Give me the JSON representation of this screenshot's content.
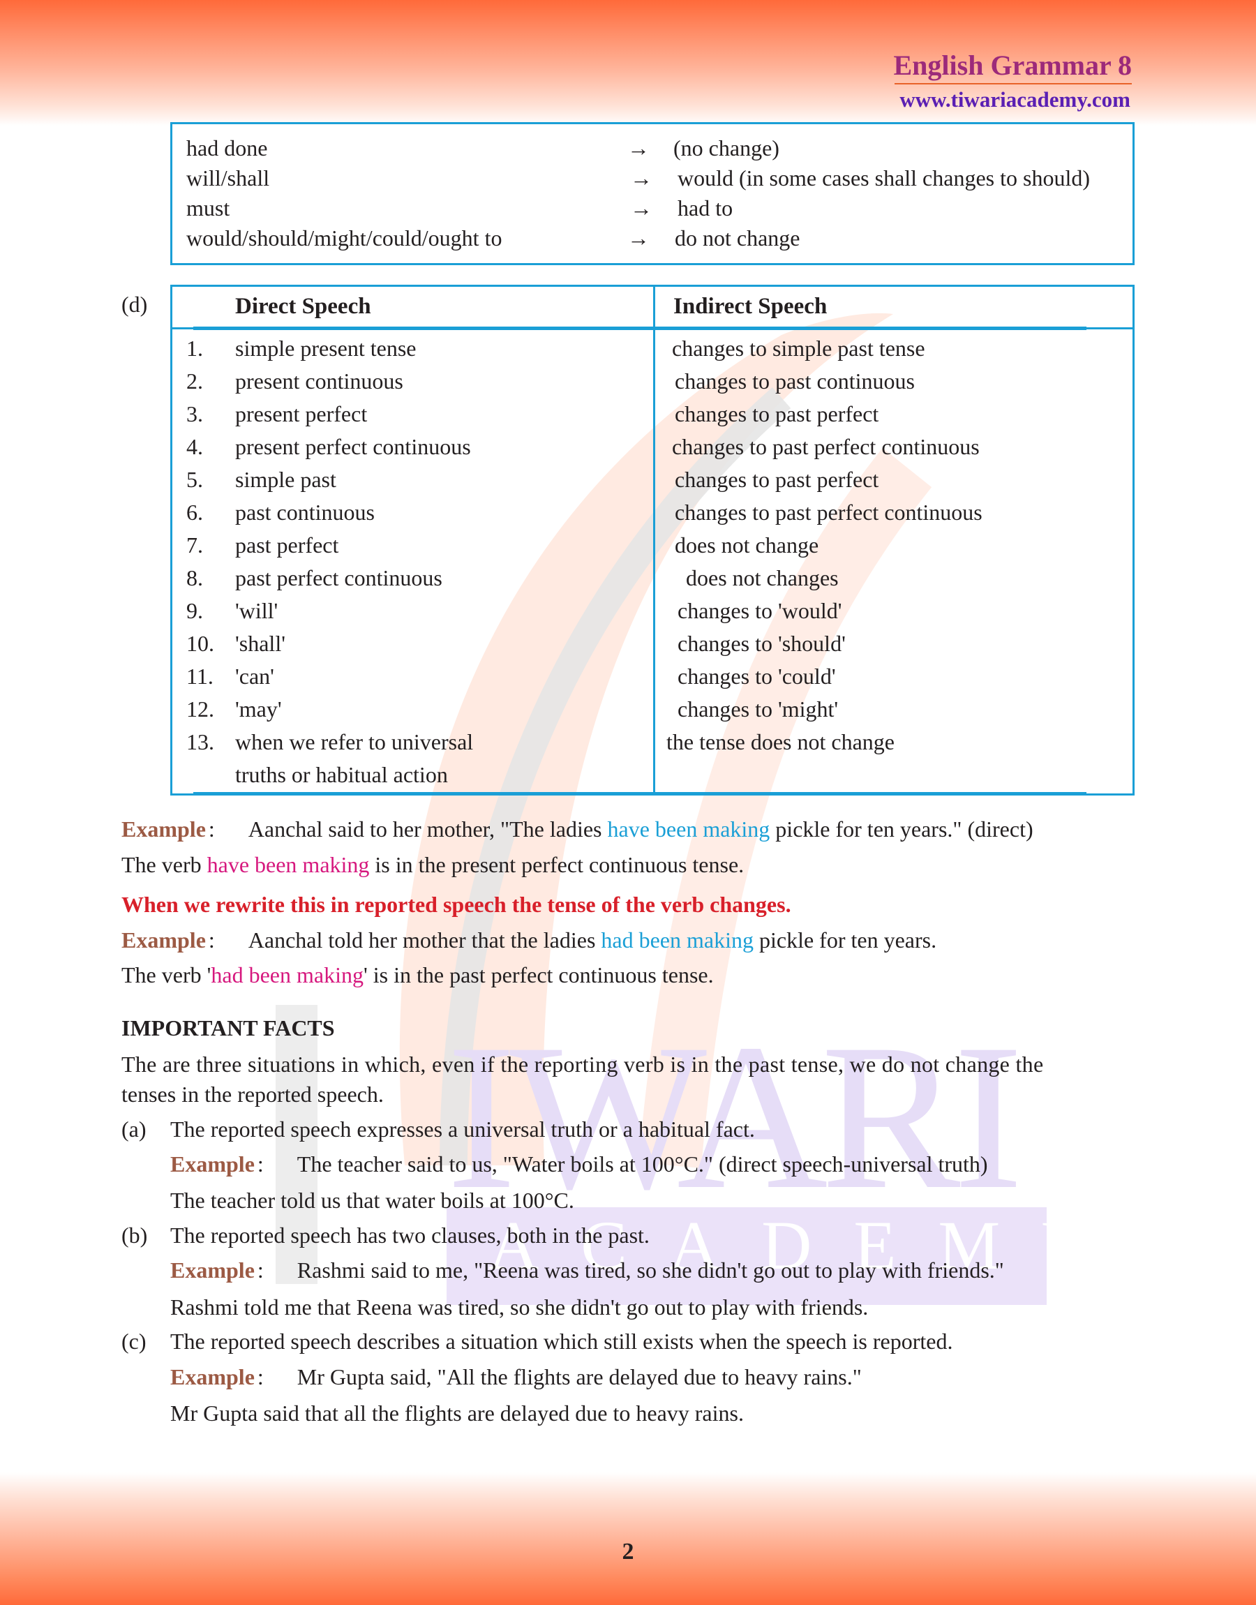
{
  "header": {
    "title": "English Grammar 8",
    "url": "www.tiwariacademy.com"
  },
  "watermark": {
    "word1": "IWARI",
    "word2": "ACADEMY"
  },
  "modal_table": {
    "arrow": "→",
    "rows": [
      {
        "from": "had done",
        "to": "(no change)"
      },
      {
        "from": "will/shall",
        "to": "would (in some cases shall changes to should)"
      },
      {
        "from": "must",
        "to": "had to"
      },
      {
        "from": "would/should/might/could/ought to",
        "to": "do not change"
      }
    ]
  },
  "tense_table": {
    "label": "(d)",
    "headers": {
      "direct": "Direct Speech",
      "indirect": "Indirect Speech"
    },
    "rows": [
      {
        "num": "1.",
        "direct": "simple present tense",
        "indirect": "changes to simple past tense"
      },
      {
        "num": "2.",
        "direct": "present continuous",
        "indirect": "changes to past continuous"
      },
      {
        "num": "3.",
        "direct": "present perfect",
        "indirect": "changes to past perfect"
      },
      {
        "num": "4.",
        "direct": "present perfect continuous",
        "indirect": "changes to past perfect continuous"
      },
      {
        "num": "5.",
        "direct": "simple past",
        "indirect": "changes to past perfect"
      },
      {
        "num": "6.",
        "direct": "past continuous",
        "indirect": "changes to past perfect continuous"
      },
      {
        "num": "7.",
        "direct": "past perfect",
        "indirect": "does not change"
      },
      {
        "num": "8.",
        "direct": "past perfect continuous",
        "indirect": "does not changes"
      },
      {
        "num": "9.",
        "direct": "'will'",
        "indirect": "changes to 'would'"
      },
      {
        "num": "10.",
        "direct": "'shall'",
        "indirect": "changes to 'should'"
      },
      {
        "num": "11.",
        "direct": "'can'",
        "indirect": "changes to 'could'"
      },
      {
        "num": "12.",
        "direct": "'may'",
        "indirect": "changes to 'might'"
      },
      {
        "num": "13.",
        "direct": "when we refer to universal",
        "indirect": "the tense does not change"
      },
      {
        "num": "",
        "direct": "truths or habitual action",
        "indirect": ""
      }
    ]
  },
  "examples": {
    "label": "Example",
    "colon": ":",
    "ex1": {
      "pre": "Aanchal said to her mother, \"The ladies ",
      "hl": "have been making",
      "post": " pickle for ten years.\" (direct)"
    },
    "ex1_note": {
      "pre": "The verb ",
      "hl": "have been making",
      "post": " is in the present perfect continuous tense."
    },
    "rule": "When we rewrite this in reported speech the tense of the verb changes.",
    "ex2": {
      "pre": "Aanchal told her mother that the ladies ",
      "hl": "had been making",
      "post": " pickle for ten years."
    },
    "ex2_note": {
      "pre": "The verb '",
      "hl": "had been making",
      "post": "' is in the past perfect continuous tense."
    }
  },
  "facts": {
    "heading": "IMPORTANT FACTS",
    "intro_line1": "The are three situations in which, even if the reporting verb is in the past tense, we do not change the",
    "intro_line2": "tenses in the reported speech.",
    "items": [
      {
        "label": "(a)",
        "text": "The reported speech expresses a universal truth or a habitual fact.",
        "example": "The teacher said to us, \"Water boils at 100°C.\" (direct speech-universal truth)",
        "result": "The teacher told us that water boils at 100°C."
      },
      {
        "label": "(b)",
        "text": "The reported speech has two clauses, both in the past.",
        "example": "Rashmi said to me, \"Reena was tired, so she didn't go out to play with friends.\"",
        "result": "Rashmi told me that Reena was tired, so she didn't go out to play with friends."
      },
      {
        "label": "(c)",
        "text": "The reported speech describes a situation which still exists when the speech is reported.",
        "example": "Mr Gupta said, \"All the flights are delayed due to heavy rains.\"",
        "result": "Mr Gupta said that all the flights are delayed due to heavy rains."
      }
    ]
  },
  "footer": {
    "page_number": "2"
  }
}
